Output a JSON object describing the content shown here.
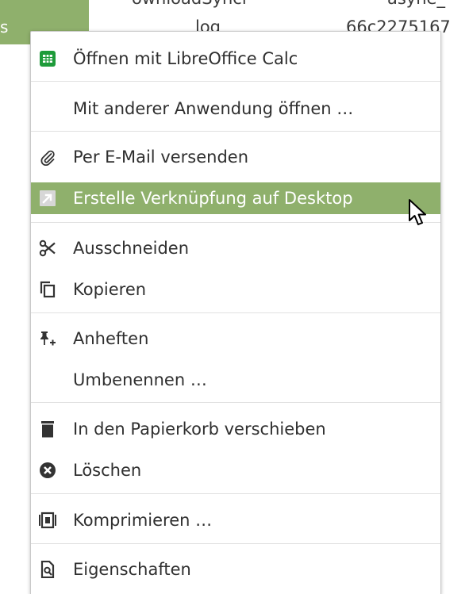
{
  "background": {
    "selected_fragment": "s",
    "name_top": "ownloadSyncl",
    "name_bottom": "log",
    "col_top": "asyne_",
    "col_bottom": "66c2275167"
  },
  "colors": {
    "accent": "#8fb06c",
    "calc_icon_green": "#1e9b3a"
  },
  "context_menu": {
    "items": [
      {
        "label": "Öffnen mit LibreOffice Calc",
        "icon": "libreoffice-calc-icon"
      },
      {
        "label": "Mit anderer Anwendung öffnen …",
        "icon": ""
      },
      {
        "label": "Per E-Mail versenden",
        "icon": "paperclip-icon"
      },
      {
        "label": "Erstelle Verknüpfung auf Desktop",
        "icon": "shortcut-arrow-icon",
        "highlighted": true
      },
      {
        "label": "Ausschneiden",
        "icon": "scissors-icon"
      },
      {
        "label": "Kopieren",
        "icon": "copy-icon"
      },
      {
        "label": "Anheften",
        "icon": "pin-icon"
      },
      {
        "label": "Umbenennen …",
        "icon": ""
      },
      {
        "label": "In den Papierkorb verschieben",
        "icon": "trash-icon"
      },
      {
        "label": "Löschen",
        "icon": "delete-circle-icon"
      },
      {
        "label": "Komprimieren …",
        "icon": "archive-icon"
      },
      {
        "label": "Eigenschaften",
        "icon": "properties-icon"
      }
    ]
  }
}
